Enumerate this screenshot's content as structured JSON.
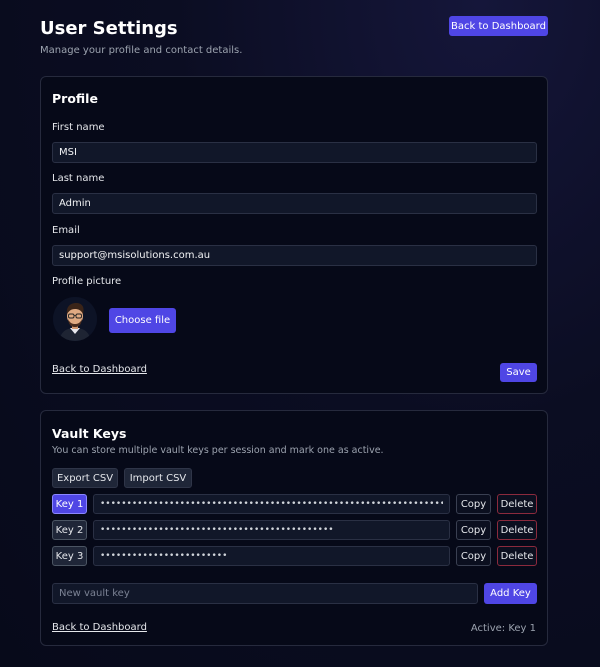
{
  "page": {
    "title": "User Settings",
    "subtitle": "Manage your profile and contact details.",
    "back_button": "Back to Dashboard"
  },
  "profile": {
    "title": "Profile",
    "first_name_label": "First name",
    "first_name": "MSI",
    "last_name_label": "Last name",
    "last_name": "Admin",
    "email_label": "Email",
    "email": "support@msisolutions.com.au",
    "picture_label": "Profile picture",
    "avatar_icon": "avatar-illustration",
    "choose_file": "Choose file",
    "back_link": "Back to Dashboard",
    "save": "Save"
  },
  "vault": {
    "title": "Vault Keys",
    "description": "You can store multiple vault keys per session and mark one as active.",
    "export_csv": "Export CSV",
    "import_csv": "Import CSV",
    "keys": [
      {
        "label": "Key 1",
        "value": "••••••••••••••••••••••••••••••••••••••••••••••••••••••••••••••••••••••••••••••••••••••",
        "copy": "Copy",
        "delete": "Delete",
        "active": true
      },
      {
        "label": "Key 2",
        "value": "••••••••••••••••••••••••••••••••••••••••••••",
        "copy": "Copy",
        "delete": "Delete",
        "active": false
      },
      {
        "label": "Key 3",
        "value": "••••••••••••••••••••••••",
        "copy": "Copy",
        "delete": "Delete",
        "active": false
      }
    ],
    "new_key_placeholder": "New vault key",
    "add_key": "Add Key",
    "back_link": "Back to Dashboard",
    "active_status": "Active: Key 1"
  },
  "colors": {
    "accent": "#4f46e5",
    "background": "#070a1a",
    "card": "#060918",
    "danger_border": "#8b2a3d"
  }
}
